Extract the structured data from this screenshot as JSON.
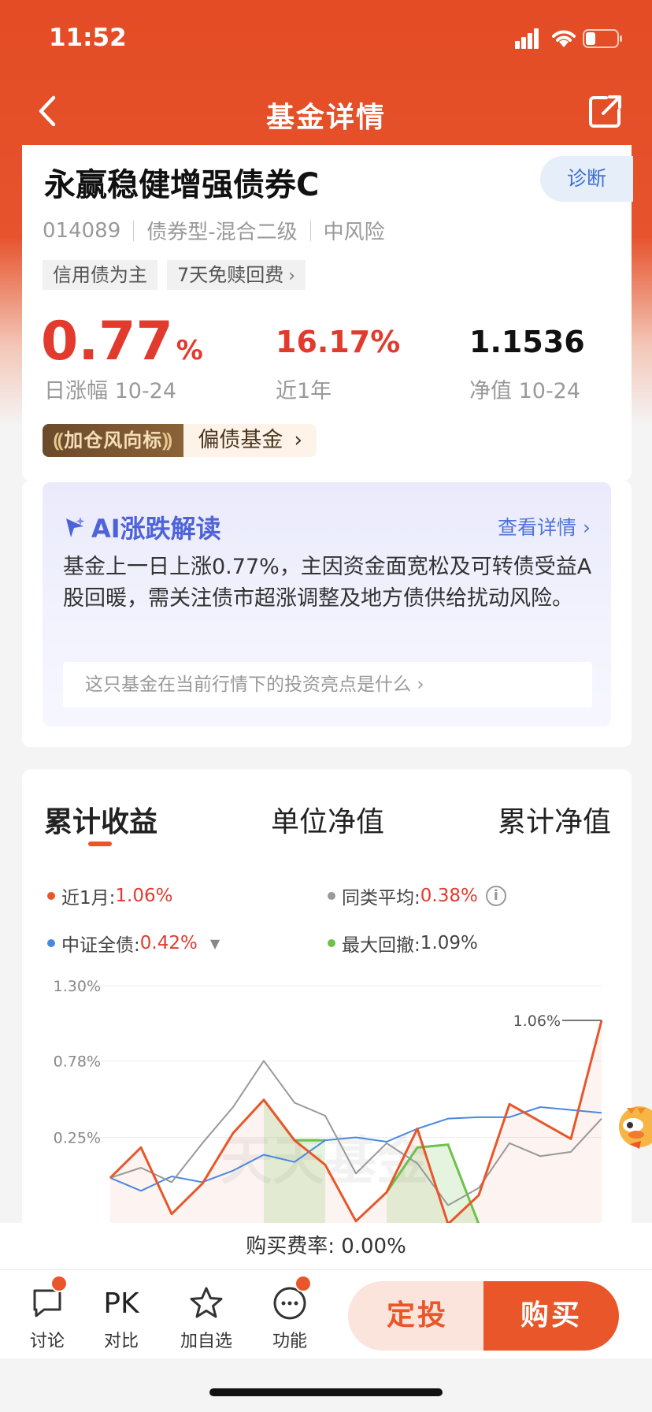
{
  "status": {
    "time": "11:52"
  },
  "nav": {
    "title": "基金详情"
  },
  "fund": {
    "name": "永赢稳健增强债券C",
    "diagnose_label": "诊断",
    "code": "014089",
    "type": "债券型-混合二级",
    "risk": "中风险",
    "tags": [
      "信用债为主",
      "7天免赎回费"
    ]
  },
  "stats": {
    "daily_change_value": "0.77",
    "daily_change_unit": "%",
    "daily_change_label": "日涨幅 10-24",
    "year_return_value": "16.17%",
    "year_return_label": "近1年",
    "nav_value": "1.1536",
    "nav_label": "净值 10-24"
  },
  "vane": {
    "badge": "加仓风向标",
    "text": "偏债基金"
  },
  "ai": {
    "title": "AI涨跌解读",
    "more": "查看详情",
    "text": "基金上一日上涨0.77%，主因资金面宽松及可转债受益A股回暖，需关注债市超涨调整及地方债供给扰动风险。",
    "question": "这只基金在当前行情下的投资亮点是什么"
  },
  "chart_tabs": [
    "累计收益",
    "单位净值",
    "累计净值"
  ],
  "legend": {
    "l1_label": "近1月:",
    "l1_value": "1.06%",
    "l2_label": "同类平均:",
    "l2_value": "0.38%",
    "l3_label": "中证全债:",
    "l3_value": "0.42%",
    "l4_label": "最大回撤:",
    "l4_value": "1.09%"
  },
  "chart_data": {
    "type": "line",
    "yticks": [
      "1.30%",
      "0.78%",
      "0.25%"
    ],
    "ylim": [
      -0.5,
      1.3
    ],
    "end_label": "1.06%",
    "watermark": "天天基金",
    "series": [
      {
        "name": "近1月",
        "color": "#e8562a",
        "values": [
          -0.03,
          0.18,
          -0.28,
          -0.07,
          0.28,
          0.51,
          0.23,
          0.06,
          -0.33,
          -0.13,
          0.31,
          -0.35,
          -0.15,
          0.48,
          0.36,
          0.24,
          1.06
        ]
      },
      {
        "name": "同类平均",
        "color": "#999999",
        "values": [
          -0.03,
          0.04,
          -0.06,
          0.21,
          0.46,
          0.78,
          0.49,
          0.4,
          0.0,
          0.21,
          0.07,
          -0.22,
          -0.1,
          0.21,
          0.12,
          0.15,
          0.38
        ]
      },
      {
        "name": "中证全债",
        "color": "#4a88e0",
        "values": [
          -0.03,
          -0.12,
          -0.02,
          -0.06,
          0.02,
          0.13,
          0.08,
          0.23,
          0.25,
          0.22,
          0.31,
          0.38,
          0.39,
          0.39,
          0.46,
          0.44,
          0.42
        ]
      }
    ],
    "drawdown_color": "#6cc24a",
    "drawdown_segments": [
      {
        "start": 5,
        "points": [
          0.51,
          0.23,
          0.23
        ]
      },
      {
        "start": 9,
        "points": [
          -0.13,
          0.18,
          0.2,
          -0.35
        ]
      }
    ],
    "drawdown_value": "1.09%"
  },
  "fee": {
    "label": "购买费率: 0.00%"
  },
  "bottom": {
    "discuss": "讨论",
    "pk_icon": "PK",
    "compare": "对比",
    "watchlist": "加自选",
    "function": "功能",
    "fixed_invest": "定投",
    "buy": "购买"
  },
  "colors": {
    "brand": "#e8562a",
    "rise": "#e23b2e",
    "ai_accent": "#4f63d8"
  }
}
